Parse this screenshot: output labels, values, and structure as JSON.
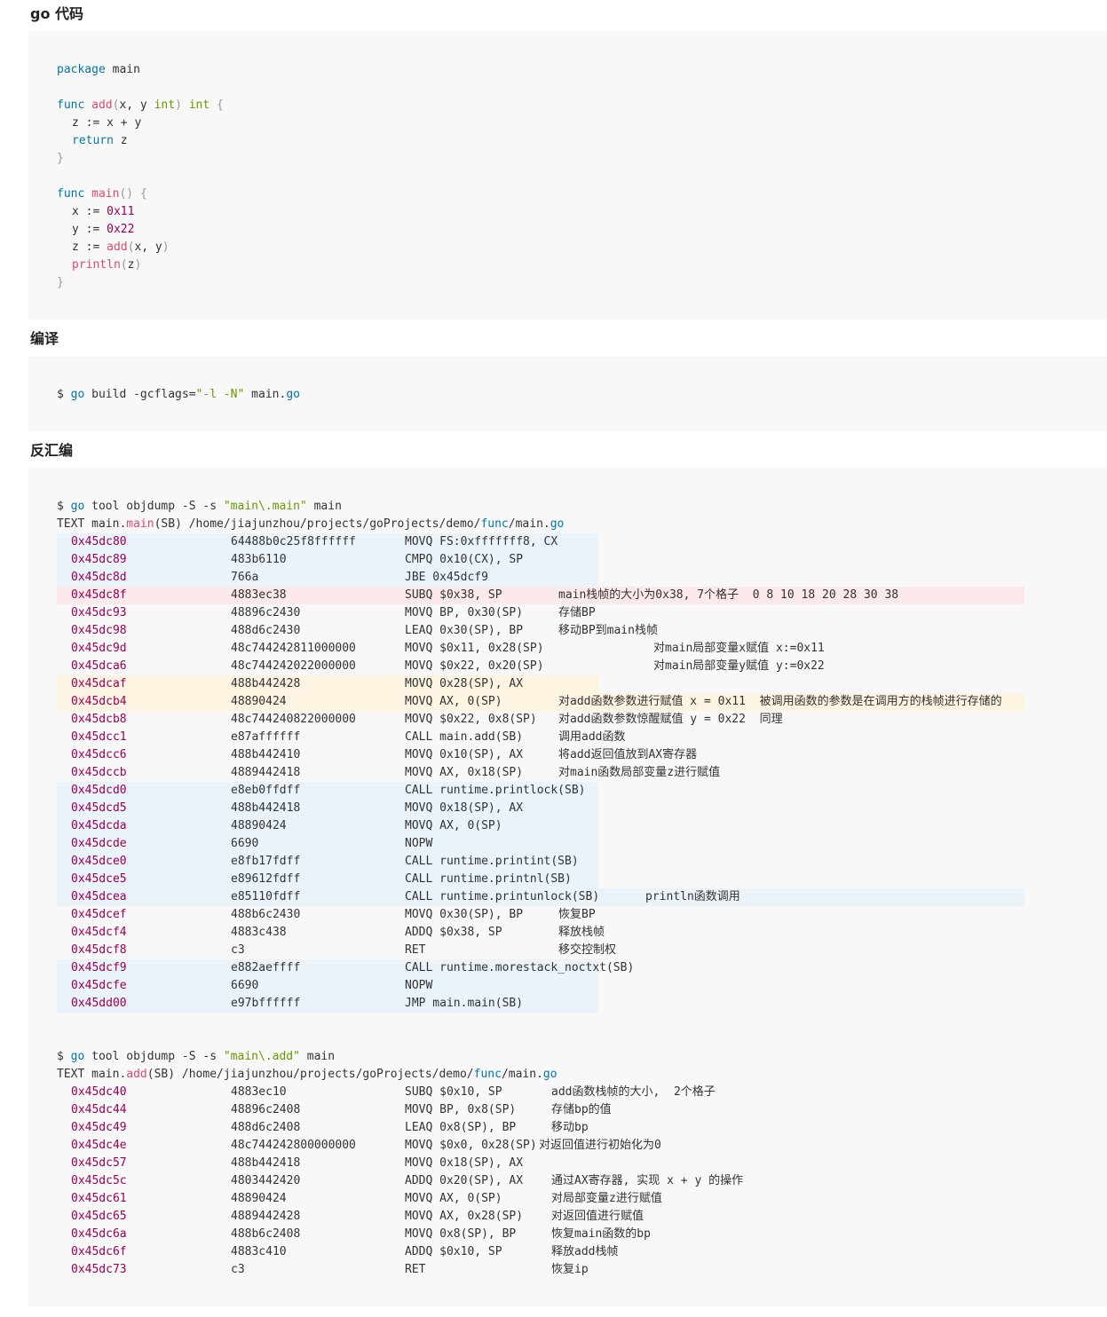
{
  "headings": {
    "go_code": "go 代码",
    "compile": "编译",
    "disasm": "反汇编"
  },
  "go_source": {
    "package_kw": "package",
    "package_name": "main",
    "func_kw": "func",
    "add_name": "add",
    "add_params": "x, y ",
    "int_kw": "int",
    "add_line2": "z := x + y",
    "return_kw": "return",
    "return_var": "z",
    "close": "}",
    "main_name": "main",
    "x_decl": "x := ",
    "x_val": "0x11",
    "y_decl": "y := ",
    "y_val": "0x22",
    "z_decl": "z := ",
    "z_args": "x, y",
    "println_name": "println",
    "println_arg": "z"
  },
  "build": {
    "prompt": "$ ",
    "go": "go",
    "cmd": " build -gcflags=",
    "flags": "\"-l -N\"",
    "file": " main.",
    "ext": "go"
  },
  "dump_main": {
    "cmd_prefix": "tool objdump -S -s ",
    "cmd_arg": "\"main\\.main\"",
    "cmd_suffix": " main",
    "text_prefix": "TEXT main.",
    "text_fn": "main",
    "text_mid": "(SB) /home/jiajunzhou/projects/goProjects/demo/",
    "text_func": "func",
    "text_file": "/main.",
    "text_ext": "go",
    "rows": [
      {
        "addr": "0x45dc80",
        "hex": "64488b0c25f8ffffff",
        "ins": "MOVQ FS:0xfffffff8, CX",
        "note": "",
        "hl": "blue"
      },
      {
        "addr": "0x45dc89",
        "hex": "483b6110",
        "ins": "CMPQ 0x10(CX), SP",
        "note": "",
        "hl": "blue"
      },
      {
        "addr": "0x45dc8d",
        "hex": "766a",
        "ins": "JBE 0x45dcf9",
        "note": "",
        "hl": "blue"
      },
      {
        "addr": "0x45dc8f",
        "hex": "4883ec38",
        "ins": "SUBQ $0x38, SP",
        "note": "main栈帧的大小为0x38, 7个格子  0 8 10 18 20 28 30 38",
        "hl": "pink"
      },
      {
        "addr": "0x45dc93",
        "hex": "48896c2430",
        "ins": "MOVQ BP, 0x30(SP)",
        "note": "存储BP",
        "hl": ""
      },
      {
        "addr": "0x45dc98",
        "hex": "488d6c2430",
        "ins": "LEAQ 0x30(SP), BP",
        "note": "移动BP到main栈帧",
        "hl": ""
      },
      {
        "addr": "0x45dc9d",
        "hex": "48c744242811000000",
        "ins": "MOVQ $0x11, 0x28(SP)",
        "note": "对main局部变量x赋值 x:=0x11",
        "hl": ""
      },
      {
        "addr": "0x45dca6",
        "hex": "48c744242022000000",
        "ins": "MOVQ $0x22, 0x20(SP)",
        "note": "对main局部变量y赋值 y:=0x22",
        "hl": ""
      },
      {
        "addr": "0x45dcaf",
        "hex": "488b442428",
        "ins": "MOVQ 0x28(SP), AX",
        "note": "",
        "hl": "yellow"
      },
      {
        "addr": "0x45dcb4",
        "hex": "48890424",
        "ins": "MOVQ AX, 0(SP)",
        "note": "对add函数参数进行赋值 x = 0x11  被调用函数的参数是在调用方的栈帧进行存储的",
        "hl": "yellow"
      },
      {
        "addr": "0x45dcb8",
        "hex": "48c744240822000000",
        "ins": "MOVQ $0x22, 0x8(SP)",
        "note": "对add函数参数惊醒赋值 y = 0x22  同理",
        "hl": ""
      },
      {
        "addr": "0x45dcc1",
        "hex": "e87affffff",
        "ins": "CALL main.add(SB)",
        "note": "调用add函数",
        "hl": ""
      },
      {
        "addr": "0x45dcc6",
        "hex": "488b442410",
        "ins": "MOVQ 0x10(SP), AX",
        "note": "将add返回值放到AX寄存器",
        "hl": ""
      },
      {
        "addr": "0x45dccb",
        "hex": "4889442418",
        "ins": "MOVQ AX, 0x18(SP)",
        "note": "对main函数局部变量z进行赋值",
        "hl": ""
      },
      {
        "addr": "0x45dcd0",
        "hex": "e8eb0ffdff",
        "ins": "CALL runtime.printlock(SB)",
        "note": "",
        "hl": "blue"
      },
      {
        "addr": "0x45dcd5",
        "hex": "488b442418",
        "ins": "MOVQ 0x18(SP), AX",
        "note": "",
        "hl": "blue"
      },
      {
        "addr": "0x45dcda",
        "hex": "48890424",
        "ins": "MOVQ AX, 0(SP)",
        "note": "",
        "hl": "blue"
      },
      {
        "addr": "0x45dcde",
        "hex": "6690",
        "ins": "NOPW",
        "note": "",
        "hl": "blue"
      },
      {
        "addr": "0x45dce0",
        "hex": "e8fb17fdff",
        "ins": "CALL runtime.printint(SB)",
        "note": "",
        "hl": "blue"
      },
      {
        "addr": "0x45dce5",
        "hex": "e89612fdff",
        "ins": "CALL runtime.printnl(SB)",
        "note": "",
        "hl": "blue"
      },
      {
        "addr": "0x45dcea",
        "hex": "e85110fdff",
        "ins": "CALL runtime.printunlock(SB)",
        "note": "println函数调用",
        "hl": "blue"
      },
      {
        "addr": "0x45dcef",
        "hex": "488b6c2430",
        "ins": "MOVQ 0x30(SP), BP",
        "note": "恢复BP",
        "hl": ""
      },
      {
        "addr": "0x45dcf4",
        "hex": "4883c438",
        "ins": "ADDQ $0x38, SP",
        "note": "释放栈帧",
        "hl": ""
      },
      {
        "addr": "0x45dcf8",
        "hex": "c3",
        "ins": "RET",
        "note": "移交控制权",
        "hl": ""
      },
      {
        "addr": "0x45dcf9",
        "hex": "e882aeffff",
        "ins": "CALL runtime.morestack_noctxt(SB)",
        "note": "",
        "hl": "blue"
      },
      {
        "addr": "0x45dcfe",
        "hex": "6690",
        "ins": "NOPW",
        "note": "",
        "hl": "blue"
      },
      {
        "addr": "0x45dd00",
        "hex": "e97bffffff",
        "ins": "JMP main.main(SB)",
        "note": "",
        "hl": "blue"
      }
    ]
  },
  "dump_add": {
    "cmd_prefix": "tool objdump -S -s ",
    "cmd_arg": "\"main\\.add\"",
    "cmd_suffix": " main",
    "text_prefix": "TEXT main.",
    "text_fn": "add",
    "text_mid": "(SB) /home/jiajunzhou/projects/goProjects/demo/",
    "text_func": "func",
    "text_file": "/main.",
    "text_ext": "go",
    "rows": [
      {
        "addr": "0x45dc40",
        "hex": "4883ec10",
        "ins": "SUBQ $0x10, SP",
        "note": "add函数栈帧的大小,  2个格子"
      },
      {
        "addr": "0x45dc44",
        "hex": "48896c2408",
        "ins": "MOVQ BP, 0x8(SP)",
        "note": "存储bp的值"
      },
      {
        "addr": "0x45dc49",
        "hex": "488d6c2408",
        "ins": "LEAQ 0x8(SP), BP",
        "note": "移动bp"
      },
      {
        "addr": "0x45dc4e",
        "hex": "48c744242800000000",
        "ins": "MOVQ $0x0, 0x28(SP)",
        "note": "对返回值进行初始化为0"
      },
      {
        "addr": "0x45dc57",
        "hex": "488b442418",
        "ins": "MOVQ 0x18(SP), AX",
        "note": ""
      },
      {
        "addr": "0x45dc5c",
        "hex": "4803442420",
        "ins": "ADDQ 0x20(SP), AX",
        "note": "通过AX寄存器, 实现 x + y 的操作"
      },
      {
        "addr": "0x45dc61",
        "hex": "48890424",
        "ins": "MOVQ AX, 0(SP)",
        "note": "对局部变量z进行赋值"
      },
      {
        "addr": "0x45dc65",
        "hex": "4889442428",
        "ins": "MOVQ AX, 0x28(SP)",
        "note": "对返回值进行赋值"
      },
      {
        "addr": "0x45dc6a",
        "hex": "488b6c2408",
        "ins": "MOVQ 0x8(SP), BP",
        "note": "恢复main函数的bp"
      },
      {
        "addr": "0x45dc6f",
        "hex": "4883c410",
        "ins": "ADDQ $0x10, SP",
        "note": "释放add栈帧"
      },
      {
        "addr": "0x45dc73",
        "hex": "c3",
        "ins": "RET",
        "note": "恢复ip"
      }
    ]
  }
}
